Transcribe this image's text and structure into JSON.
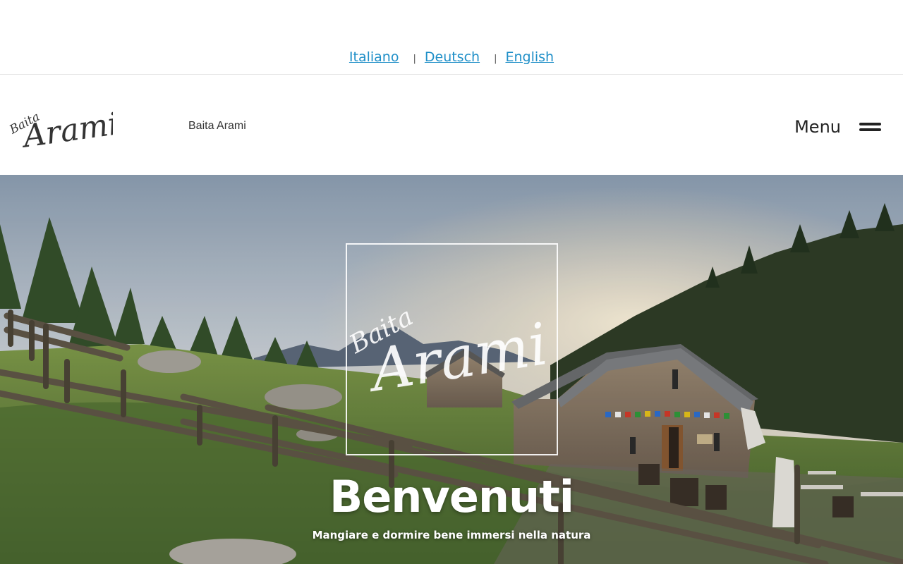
{
  "languages": [
    {
      "label": "Italiano"
    },
    {
      "label": "Deutsch"
    },
    {
      "label": "English"
    }
  ],
  "language_separator": "|",
  "header": {
    "site_name": "Baita Arami",
    "menu_label": "Menu",
    "logo_text_small": "Baita",
    "logo_text_large": "Arami"
  },
  "hero": {
    "title": "Benvenuti",
    "subtitle": "Mangiare e dormire bene immersi nella natura",
    "logo_text_small": "Baita",
    "logo_text_large": "Arami"
  },
  "colors": {
    "link": "#1f8fc8",
    "text": "#222222"
  }
}
